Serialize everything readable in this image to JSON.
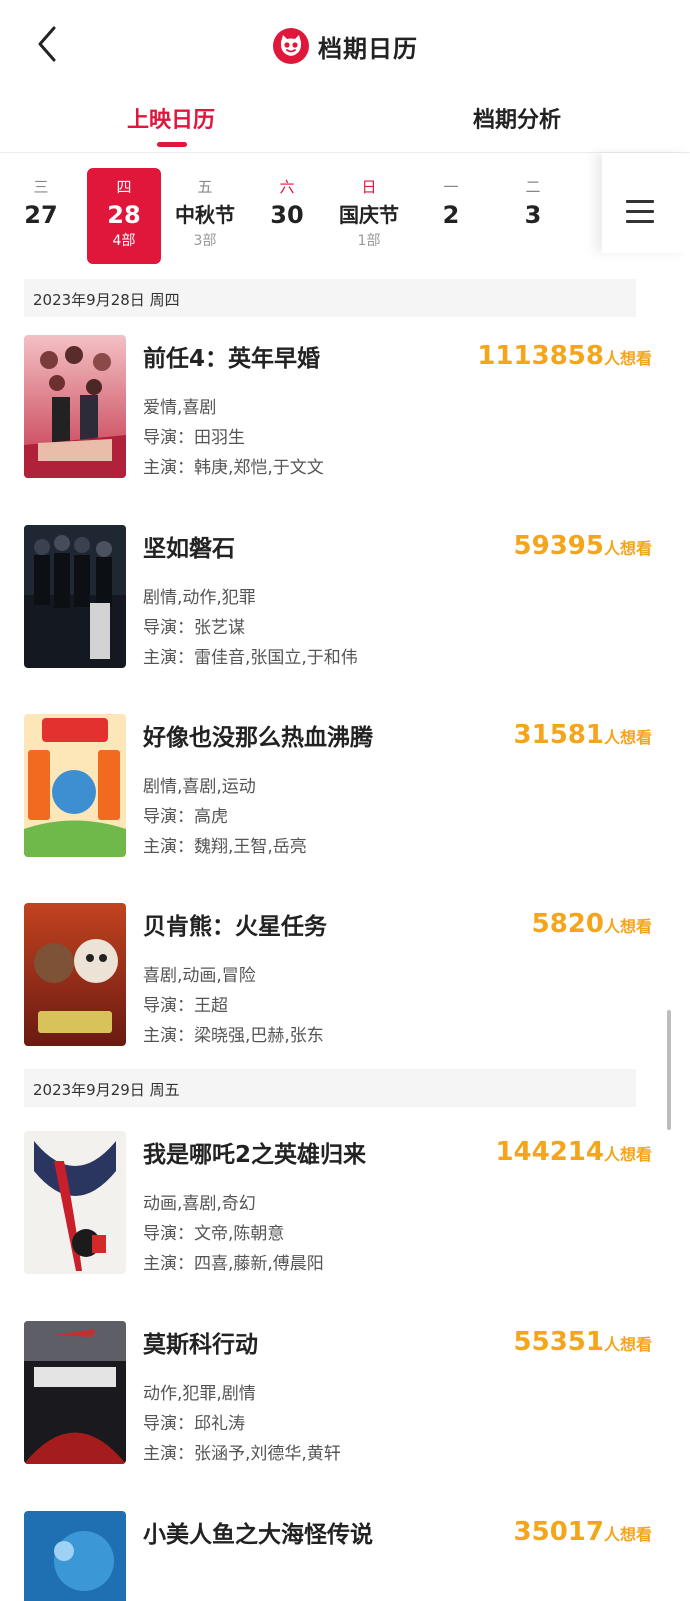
{
  "header": {
    "title": "档期日历",
    "back_icon": "chevron-left-icon",
    "logo_icon": "maoyan-cat-logo",
    "accent_color": "#e0163a"
  },
  "tabs": [
    {
      "label": "上映日历",
      "active": true
    },
    {
      "label": "档期分析",
      "active": false
    }
  ],
  "date_strip": {
    "days": [
      {
        "weekday": "三",
        "date": "27",
        "count": "",
        "selected": false,
        "weekend": false
      },
      {
        "weekday": "四",
        "date": "28",
        "count": "4部",
        "selected": true,
        "weekend": false
      },
      {
        "weekday": "五",
        "date": "中秋节",
        "count": "3部",
        "selected": false,
        "weekend": false
      },
      {
        "weekday": "六",
        "date": "30",
        "count": "",
        "selected": false,
        "weekend": true
      },
      {
        "weekday": "日",
        "date": "国庆节",
        "count": "1部",
        "selected": false,
        "weekend": true
      },
      {
        "weekday": "一",
        "date": "2",
        "count": "",
        "selected": false,
        "weekend": false
      },
      {
        "weekday": "二",
        "date": "3",
        "count": "",
        "selected": false,
        "weekend": false
      }
    ],
    "menu_icon": "menu-icon"
  },
  "sections": [
    {
      "date_label": "2023年9月28日  周四",
      "movies": [
        {
          "title": "前任4：英年早婚",
          "wish_count": "1113858",
          "wish_unit": "人想看",
          "genre": "爱情,喜剧",
          "director": "导演：田羽生",
          "cast": "主演：韩庚,郑恺,于文文"
        },
        {
          "title": "坚如磐石",
          "wish_count": "59395",
          "wish_unit": "人想看",
          "genre": "剧情,动作,犯罪",
          "director": "导演：张艺谋",
          "cast": "主演：雷佳音,张国立,于和伟"
        },
        {
          "title": "好像也没那么热血沸腾",
          "wish_count": "31581",
          "wish_unit": "人想看",
          "genre": "剧情,喜剧,运动",
          "director": "导演：高虎",
          "cast": "主演：魏翔,王智,岳亮"
        },
        {
          "title": "贝肯熊：火星任务",
          "wish_count": "5820",
          "wish_unit": "人想看",
          "genre": "喜剧,动画,冒险",
          "director": "导演：王超",
          "cast": "主演：梁晓强,巴赫,张东"
        }
      ]
    },
    {
      "date_label": "2023年9月29日  周五",
      "movies": [
        {
          "title": "我是哪吒2之英雄归来",
          "wish_count": "144214",
          "wish_unit": "人想看",
          "genre": "动画,喜剧,奇幻",
          "director": "导演：文帝,陈朝意",
          "cast": "主演：四喜,藤新,傅晨阳"
        },
        {
          "title": "莫斯科行动",
          "wish_count": "55351",
          "wish_unit": "人想看",
          "genre": "动作,犯罪,剧情",
          "director": "导演：邱礼涛",
          "cast": "主演：张涵予,刘德华,黄轩"
        },
        {
          "title": "小美人鱼之大海怪传说",
          "wish_count": "35017",
          "wish_unit": "人想看",
          "genre": "",
          "director": "",
          "cast": ""
        }
      ]
    }
  ]
}
